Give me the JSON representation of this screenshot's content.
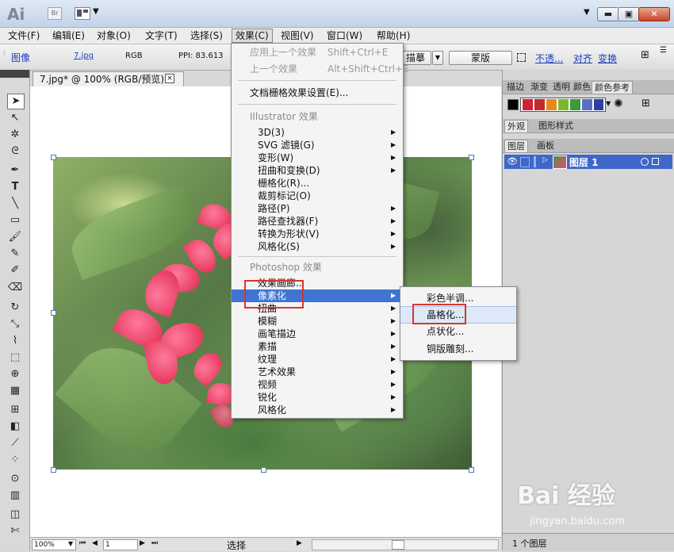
{
  "titlebar": {
    "app_logo": "Ai",
    "bridge_label": "Br"
  },
  "menubar": {
    "items": [
      {
        "label": "文件(F)"
      },
      {
        "label": "编辑(E)"
      },
      {
        "label": "对象(O)"
      },
      {
        "label": "文字(T)"
      },
      {
        "label": "选择(S)"
      },
      {
        "label": "效果(C)"
      },
      {
        "label": "视图(V)"
      },
      {
        "label": "窗口(W)"
      },
      {
        "label": "帮助(H)"
      }
    ]
  },
  "control_bar": {
    "object_type": "图像",
    "file_name": "7.jpg",
    "color_mode": "RGB",
    "ppi": "PPI: 83.613",
    "trace_label": "描摹",
    "mask_label": "蒙版",
    "opacity_label": "不透...",
    "align_label": "对齐",
    "transform_label": "变换"
  },
  "document": {
    "tab_title": "7.jpg* @ 100% (RGB/预览)",
    "close_glyph": "☒"
  },
  "status_bar": {
    "zoom": "100%",
    "page": "1",
    "tool_status": "选择"
  },
  "panels": {
    "top_tabs": [
      "描边",
      "渐变",
      "透明",
      "颜色",
      "颜色参考"
    ],
    "mid_tabs": [
      "外观",
      "图形样式"
    ],
    "layer_tabs": [
      "图层",
      "画板"
    ],
    "layer_name": "图层 1",
    "layers_count": "1 个图层",
    "swatches": [
      "#d1203a",
      "#c22a2a",
      "#e58a1a",
      "#78b92e",
      "#3b9a3b",
      "#5c6ec4",
      "#2c3fa8"
    ]
  },
  "effect_menu": {
    "items": [
      {
        "label": "应用上一个效果",
        "shortcut": "Shift+Ctrl+E",
        "state": "disabled"
      },
      {
        "label": "上一个效果",
        "shortcut": "Alt+Shift+Ctrl+E",
        "state": "disabled"
      },
      {
        "label": "文档栅格效果设置(E)...",
        "state": "normal"
      },
      {
        "label": "Illustrator 效果",
        "state": "header"
      },
      {
        "label": "3D(3)",
        "state": "normal",
        "submenu": true
      },
      {
        "label": "SVG 滤镜(G)",
        "state": "normal",
        "submenu": true
      },
      {
        "label": "变形(W)",
        "state": "normal",
        "submenu": true
      },
      {
        "label": "扭曲和变换(D)",
        "state": "normal",
        "submenu": true
      },
      {
        "label": "栅格化(R)...",
        "state": "normal"
      },
      {
        "label": "裁剪标记(O)",
        "state": "normal"
      },
      {
        "label": "路径(P)",
        "state": "normal",
        "submenu": true
      },
      {
        "label": "路径查找器(F)",
        "state": "normal",
        "submenu": true
      },
      {
        "label": "转换为形状(V)",
        "state": "normal",
        "submenu": true
      },
      {
        "label": "风格化(S)",
        "state": "normal",
        "submenu": true
      },
      {
        "label": "Photoshop 效果",
        "state": "header"
      },
      {
        "label": "效果画廊...",
        "state": "normal"
      },
      {
        "label": "像素化",
        "state": "highlight",
        "submenu": true
      },
      {
        "label": "扭曲",
        "state": "normal",
        "submenu": true
      },
      {
        "label": "模糊",
        "state": "normal",
        "submenu": true
      },
      {
        "label": "画笔描边",
        "state": "normal",
        "submenu": true
      },
      {
        "label": "素描",
        "state": "normal",
        "submenu": true
      },
      {
        "label": "纹理",
        "state": "normal",
        "submenu": true
      },
      {
        "label": "艺术效果",
        "state": "normal",
        "submenu": true
      },
      {
        "label": "视频",
        "state": "normal",
        "submenu": true
      },
      {
        "label": "锐化",
        "state": "normal",
        "submenu": true
      },
      {
        "label": "风格化",
        "state": "normal",
        "submenu": true
      }
    ]
  },
  "pixelate_submenu": {
    "items": [
      {
        "label": "彩色半调..."
      },
      {
        "label": "晶格化..."
      },
      {
        "label": "点状化..."
      },
      {
        "label": "铜版雕刻..."
      }
    ]
  },
  "watermark": {
    "brand": "Bai 经验",
    "url": "jingyan.baidu.com"
  }
}
